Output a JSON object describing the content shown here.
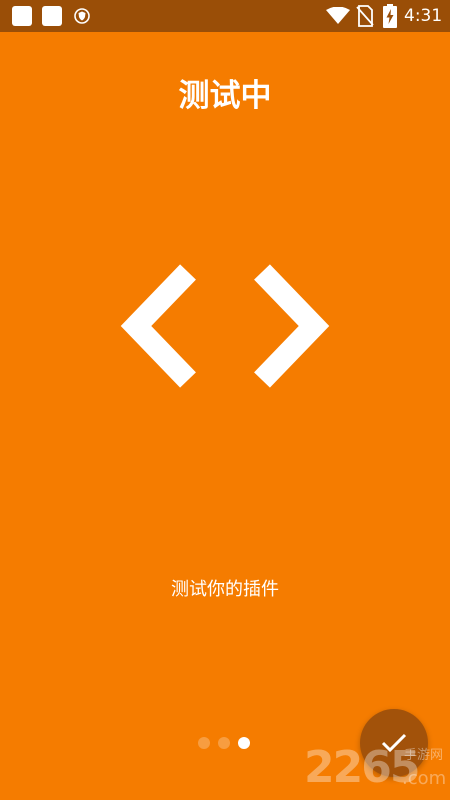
{
  "status_bar": {
    "time": "4:31",
    "icons": [
      "app-icon",
      "app-icon",
      "shield-icon",
      "wifi-icon",
      "no-sim-icon",
      "battery-charging-icon"
    ]
  },
  "onboarding": {
    "title": "测试中",
    "icon": "code-brackets-icon",
    "subtitle": "测试你的插件",
    "page_indicator": {
      "count": 3,
      "active_index": 2
    },
    "fab_icon": "check-icon"
  },
  "watermark": {
    "number": "2265",
    "text": "手游网",
    "suffix": ".com"
  },
  "colors": {
    "background": "#F57C00",
    "status_bar": "#9A4E07",
    "fab": "#A2520A",
    "foreground": "#FFFFFF"
  }
}
